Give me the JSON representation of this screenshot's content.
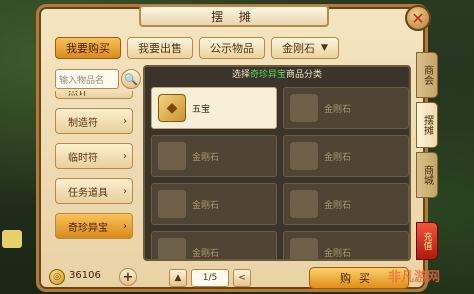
{
  "window": {
    "title": "摆 摊"
  },
  "top_tabs": [
    {
      "label": "我要购买",
      "active": true
    },
    {
      "label": "我要出售",
      "active": false
    },
    {
      "label": "公示物品",
      "active": false
    },
    {
      "label": "金刚石",
      "active": false
    }
  ],
  "search": {
    "placeholder": "输入物品名"
  },
  "categories": [
    {
      "label": "杰计",
      "partial": true,
      "active": false
    },
    {
      "label": "制造符",
      "partial": false,
      "active": false
    },
    {
      "label": "临时符",
      "partial": false,
      "active": false
    },
    {
      "label": "任务道具",
      "partial": false,
      "active": false
    },
    {
      "label": "奇珍异宝",
      "partial": false,
      "active": true
    }
  ],
  "panel": {
    "head_prefix": "选择",
    "head_highlight": "奇珍异宝",
    "head_suffix": "商品分类"
  },
  "items": [
    [
      "五宝",
      "金刚石"
    ],
    [
      "金刚石",
      "金刚石"
    ],
    [
      "金刚石",
      "金刚石"
    ],
    [
      "金刚石",
      "金刚石"
    ]
  ],
  "wallet": {
    "amount": "36106"
  },
  "pager": {
    "page": "1/5",
    "prev": "<",
    "up": "▲"
  },
  "buy_button": {
    "label": "购买"
  },
  "side_tabs": [
    "商会",
    "摆摊",
    "商城"
  ],
  "recharge": "充值",
  "watermark": "非凡游网"
}
